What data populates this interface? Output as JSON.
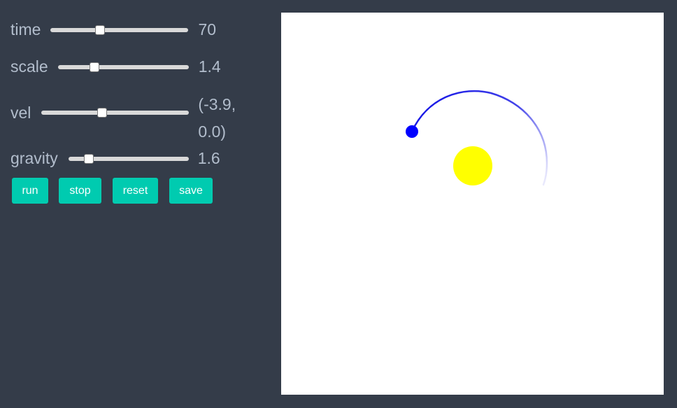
{
  "controls": {
    "time": {
      "label": "time",
      "value": "70",
      "fraction": 0.36
    },
    "scale": {
      "label": "scale",
      "value": "1.4",
      "fraction": 0.28
    },
    "vel": {
      "label": "vel",
      "value": "(-3.9, 0.0)",
      "fraction": 0.41
    },
    "gravity": {
      "label": "gravity",
      "value": "1.6",
      "fraction": 0.17
    }
  },
  "buttons": {
    "run": "run",
    "stop": "stop",
    "reset": "reset",
    "save": "save"
  },
  "colors": {
    "background": "#343c49",
    "label": "#b2bdcc",
    "button": "#00cbb0",
    "sun": "#ffff00",
    "planet": "#0000ff",
    "trail": "#2a2ae0"
  },
  "icons": {
    "sun": "yellow-circle",
    "planet": "blue-dot"
  }
}
